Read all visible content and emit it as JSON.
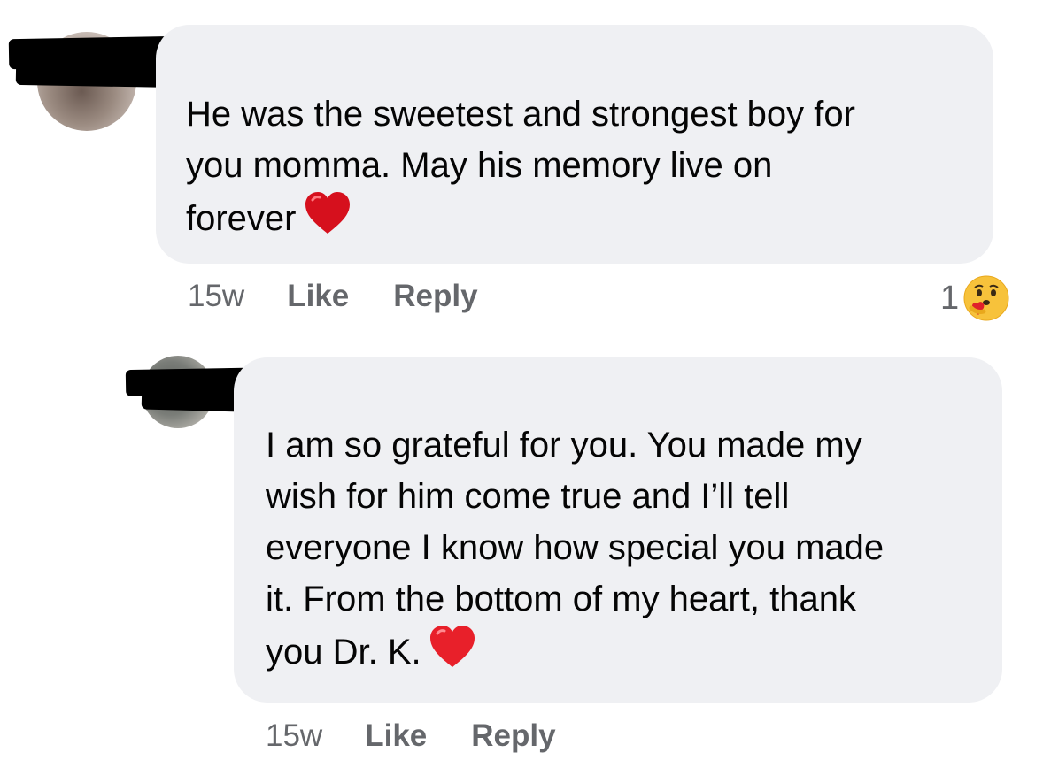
{
  "comments": [
    {
      "text": "He was the sweetest and strongest boy for\nyou momma. May his memory live on\nforever",
      "emoji": "red-heart",
      "time": "15w",
      "like_label": "Like",
      "reply_label": "Reply",
      "reaction_count": "1",
      "reaction_emoji": "care-hug"
    },
    {
      "text": "I am so grateful for you. You made my\nwish for him come true and I’ll tell\neveryone I know how special you made\nit. From the bottom of my heart, thank\nyou  Dr. K.",
      "emoji": "red-heart",
      "time": "15w",
      "like_label": "Like",
      "reply_label": "Reply"
    }
  ],
  "colors": {
    "bubble": "#eff0f3",
    "meta_text": "#65676b",
    "heart": "#e0202a",
    "care_emoji": "#f7b125"
  }
}
